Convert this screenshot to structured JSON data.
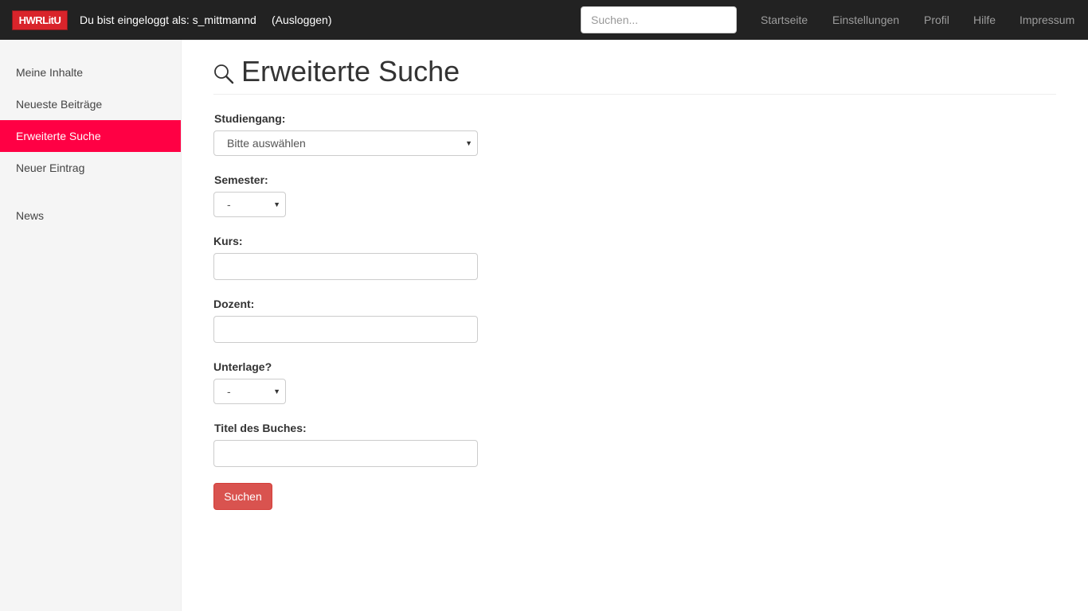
{
  "navbar": {
    "logo_text": "HWRLitU",
    "logged_in_text": "Du bist eingeloggt als: s_mittmannd",
    "logout_label": "(Ausloggen)",
    "search_placeholder": "Suchen...",
    "links": [
      "Startseite",
      "Einstellungen",
      "Profil",
      "Hilfe",
      "Impressum"
    ]
  },
  "sidebar": {
    "items": [
      {
        "label": "Meine Inhalte",
        "active": false
      },
      {
        "label": "Neueste Beiträge",
        "active": false
      },
      {
        "label": "Erweiterte Suche",
        "active": true
      },
      {
        "label": "Neuer Eintrag",
        "active": false
      },
      {
        "label": "News",
        "active": false
      }
    ],
    "active_color": "#ff0044"
  },
  "main": {
    "title": "Erweiterte Suche",
    "title_icon": "search-icon",
    "form": {
      "studiengang_label": "Studiengang:",
      "studiengang_value": "Bitte auswählen",
      "semester_label": "Semester:",
      "semester_value": "-",
      "kurs_label": "Kurs:",
      "kurs_value": "",
      "dozent_label": "Dozent:",
      "dozent_value": "",
      "unterlage_label": "Unterlage?",
      "unterlage_value": "-",
      "titel_label": "Titel des Buches:",
      "titel_value": "",
      "submit_label": "Suchen"
    }
  },
  "colors": {
    "navbar_bg": "#222222",
    "brand_red": "#d9242b",
    "button_red": "#d9534f"
  }
}
